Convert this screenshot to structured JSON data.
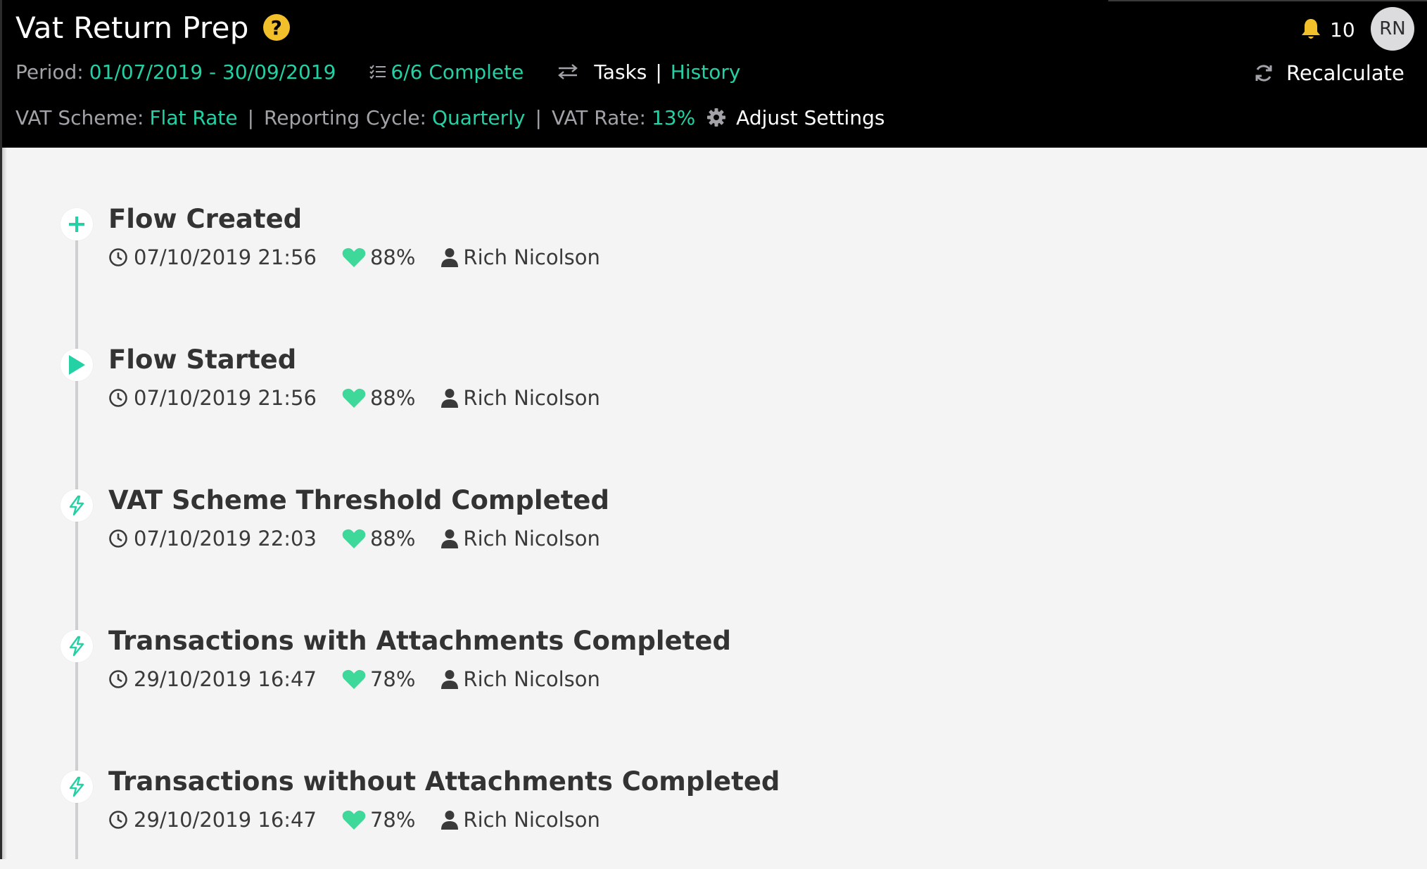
{
  "header": {
    "title": "Vat Return Prep",
    "help_icon": "help-circle-icon",
    "period_label": "Period:",
    "period_value": "01/07/2019 - 30/09/2019",
    "tasks_status": "6/6 Complete",
    "tasks_link": "Tasks",
    "tasks_divider": "|",
    "history_link": "History",
    "vat_scheme_label": "VAT Scheme:",
    "vat_scheme_value": "Flat Rate",
    "reporting_cycle_label": "Reporting Cycle:",
    "reporting_cycle_value": "Quarterly",
    "vat_rate_label": "VAT Rate:",
    "vat_rate_value": "13%",
    "adjust_settings": "Adjust Settings",
    "separator": "|",
    "notification_count": "10",
    "avatar_initials": "RN",
    "recalculate": "Recalculate"
  },
  "colors": {
    "accent": "#24d1a4",
    "header_bg": "#000000",
    "help": "#f2c02b",
    "bell": "#f2c02b",
    "heart": "#3ed89a",
    "text_dark": "#333333"
  },
  "timeline": [
    {
      "icon": "plus-icon",
      "title": "Flow Created",
      "timestamp": "07/10/2019 21:56",
      "score": "88%",
      "user": "Rich Nicolson"
    },
    {
      "icon": "play-icon",
      "title": "Flow Started",
      "timestamp": "07/10/2019 21:56",
      "score": "88%",
      "user": "Rich Nicolson"
    },
    {
      "icon": "bolt-icon",
      "title": "VAT Scheme Threshold Completed",
      "timestamp": "07/10/2019 22:03",
      "score": "88%",
      "user": "Rich Nicolson"
    },
    {
      "icon": "bolt-icon",
      "title": "Transactions with Attachments Completed",
      "timestamp": "29/10/2019 16:47",
      "score": "78%",
      "user": "Rich Nicolson"
    },
    {
      "icon": "bolt-icon",
      "title": "Transactions without Attachments Completed",
      "timestamp": "29/10/2019 16:47",
      "score": "78%",
      "user": "Rich Nicolson"
    }
  ]
}
